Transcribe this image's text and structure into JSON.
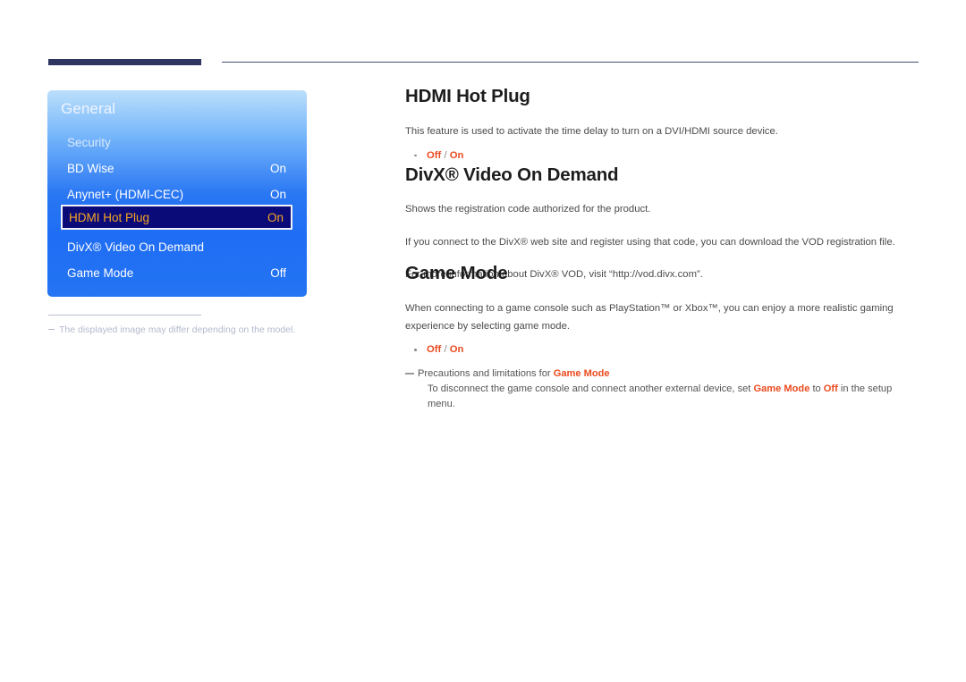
{
  "header": {
    "thick_bar": "navy-accent-bar",
    "rule_color": "#4b4f77"
  },
  "osd_panel": {
    "title": "General",
    "rows": [
      {
        "label": "Security",
        "value": ""
      },
      {
        "label": "BD Wise",
        "value": "On"
      },
      {
        "label": "Anynet+ (HDMI-CEC)",
        "value": "On"
      },
      {
        "label": "HDMI Hot Plug",
        "value": "On"
      },
      {
        "label": "DivX® Video On Demand",
        "value": ""
      },
      {
        "label": "Game Mode",
        "value": "Off"
      }
    ],
    "selected_index": 3,
    "colors": {
      "panel_top": "#bcdffb",
      "panel_bottom": "#2474f4",
      "highlight_bg": "#0a0a78",
      "highlight_border": "#f2f2fb",
      "highlight_text": "#f5a623"
    }
  },
  "panel_footnote": {
    "text": "The displayed image may differ depending on the model."
  },
  "content": {
    "sections": [
      {
        "heading": "HDMI Hot Plug",
        "body": "This feature is used to activate the time delay to turn on a DVI/HDMI source device.",
        "bullet": {
          "off": "Off",
          "separator": " / ",
          "on": "On"
        }
      },
      {
        "heading": "DivX® Video On Demand",
        "body_line1": "Shows the registration code authorized for the product.",
        "body_line2": "If you connect to the DivX® web site and register using that code, you can download the VOD registration file.",
        "body_line3": "For more information about DivX® VOD, visit “http://vod.divx.com”."
      },
      {
        "heading": "Game Mode",
        "body": "When connecting to a game console such as PlayStation™ or Xbox™, you can enjoy a more realistic gaming experience by selecting game mode.",
        "bullet": {
          "off": "Off",
          "separator": " / ",
          "on": "On"
        },
        "note": {
          "head_prefix": "Precautions and limitations for ",
          "head_bold": "Game Mode",
          "sub_part1": "To disconnect the game console and connect another external device, set ",
          "sub_bold1": "Game Mode",
          "sub_part2": " to ",
          "sub_bold2": "Off",
          "sub_part3": " in the setup menu."
        }
      }
    ]
  }
}
